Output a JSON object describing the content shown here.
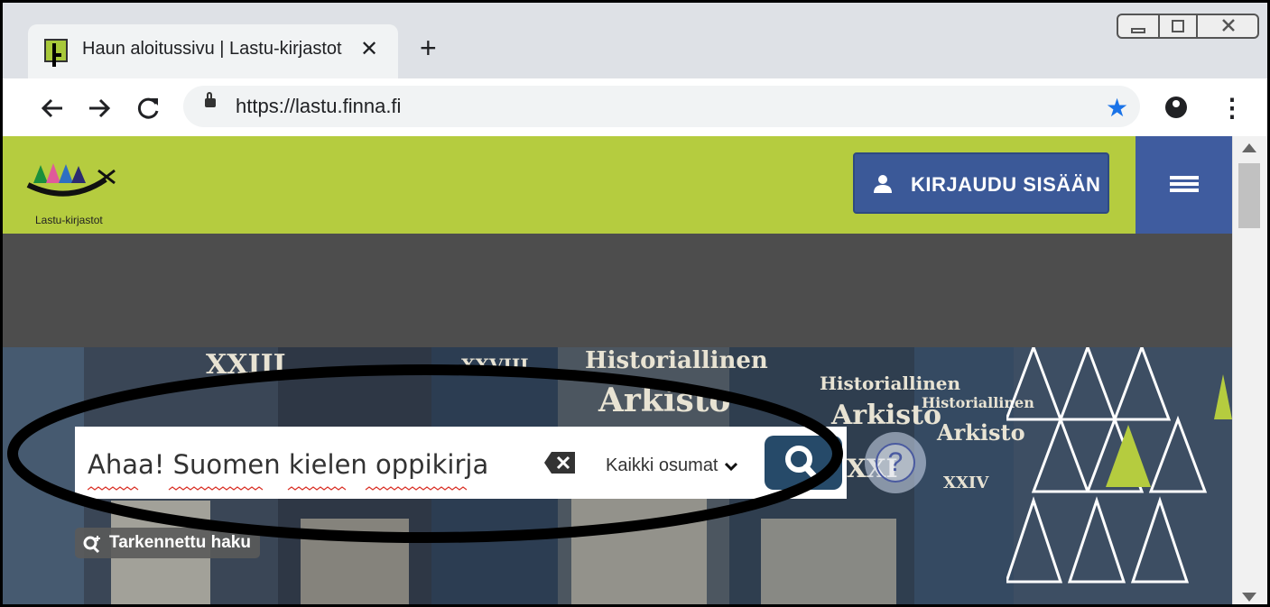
{
  "browser": {
    "tab_title": "Haun aloitussivu | Lastu-kirjastot",
    "tab_close": "✕",
    "new_tab": "+",
    "url": "https://lastu.finna.fi",
    "icons": [
      "back-icon",
      "forward-icon",
      "reload-icon",
      "lock-icon",
      "star-icon",
      "profile-icon",
      "kebab-menu-icon"
    ]
  },
  "site": {
    "logo_text": "Lastu-kirjastot",
    "login_label": "KIRJAUDU SISÄÄN",
    "brand_green": "#b5cc3f",
    "brand_blue": "#3b5998"
  },
  "search": {
    "query": "Ahaa! Suomen kielen oppikirja",
    "scope_label": "Kaikki osumat",
    "help_label": "?",
    "advanced_label": "Tarkennettu haku"
  },
  "hero_texts": {
    "t1": "XXIII",
    "t2": "XXVIII",
    "t3": "Historiallinen",
    "t4": "Arkisto",
    "t5": "Historiallinen",
    "t6": "Arkisto",
    "t7": "XXI",
    "t8": "Historiallinen",
    "t9": "Arkisto",
    "t10": "XXIV"
  }
}
